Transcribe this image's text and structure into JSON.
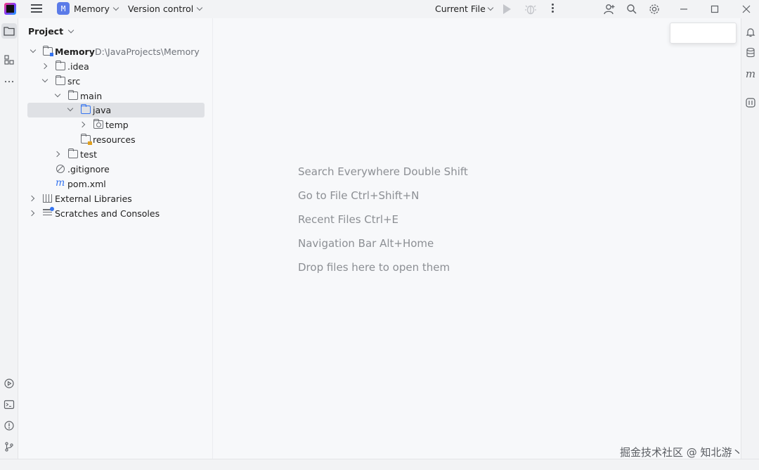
{
  "titlebar": {
    "project_badge": "M",
    "project_name": "Memory",
    "version_control": "Version control",
    "run_config": "Current File"
  },
  "panel": {
    "title": "Project"
  },
  "tree": {
    "root": {
      "name": "Memory",
      "path": "D:\\JavaProjects\\Memory"
    },
    "idea": ".idea",
    "src": "src",
    "main": "main",
    "java": "java",
    "temp": "temp",
    "resources": "resources",
    "test": "test",
    "gitignore": ".gitignore",
    "pom": "pom.xml",
    "external_libraries": "External Libraries",
    "scratches": "Scratches and Consoles"
  },
  "editor": {
    "hints": [
      "Search Everywhere Double Shift",
      "Go to File Ctrl+Shift+N",
      "Recent Files Ctrl+E",
      "Navigation Bar Alt+Home",
      "Drop files here to open them"
    ]
  },
  "rstrip": {
    "maven_letter": "m"
  },
  "watermark": "掘金技术社区 @ 知北游丶"
}
